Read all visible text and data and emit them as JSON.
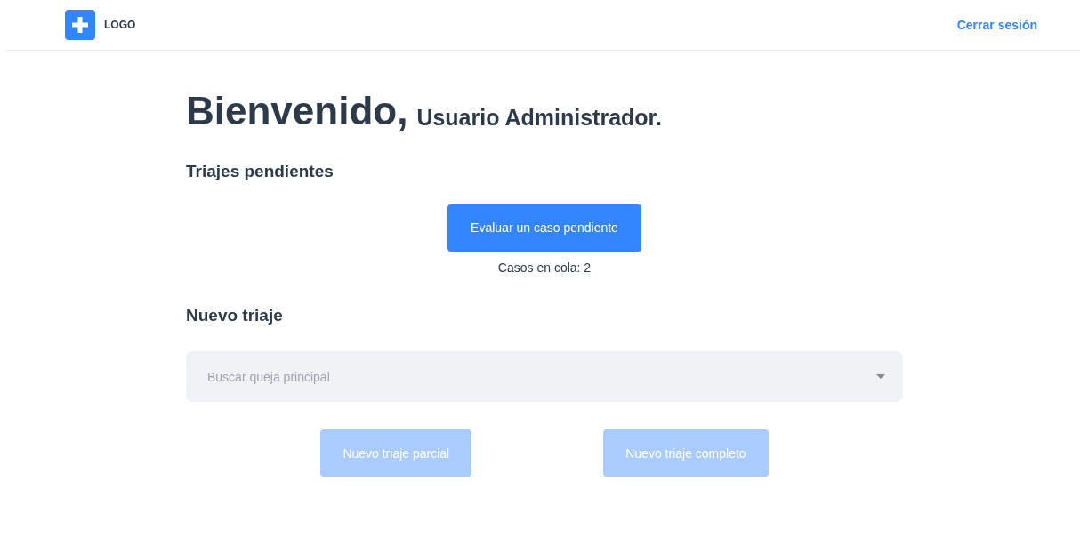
{
  "header": {
    "logo_text": "LOGO",
    "logout": "Cerrar sesión"
  },
  "welcome": {
    "greeting": "Bienvenido,",
    "user": "Usuario Administrador."
  },
  "pending": {
    "heading": "Triajes pendientes",
    "button": {
      "label": "Evaluar un caso pendiente",
      "disabled": false
    },
    "queue": "Casos en cola: 2"
  },
  "new_triage": {
    "heading": "Nuevo triaje",
    "search": {
      "placeholder": "Buscar queja principal"
    },
    "buttons": [
      {
        "label": "Nuevo triaje parcial",
        "disabled": true
      },
      {
        "label": "Nuevo triaje completo",
        "disabled": true
      }
    ]
  }
}
